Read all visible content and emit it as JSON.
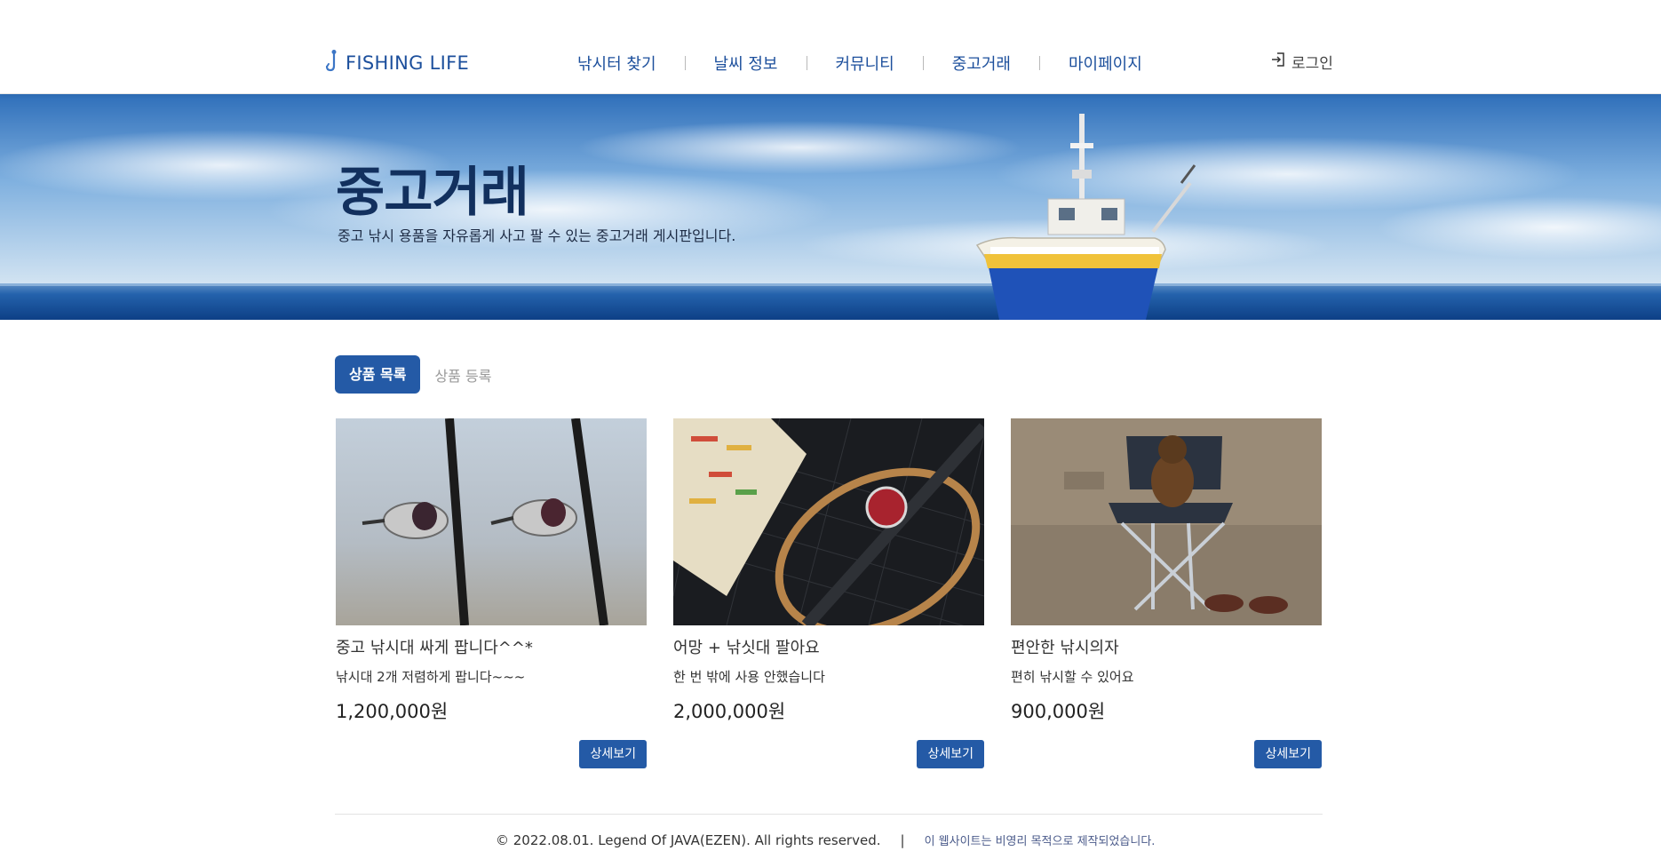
{
  "header": {
    "logo_text": "FISHING LIFE",
    "nav": [
      {
        "label": "낚시터 찾기"
      },
      {
        "label": "날씨 정보"
      },
      {
        "label": "커뮤니티"
      },
      {
        "label": "중고거래"
      },
      {
        "label": "마이페이지"
      }
    ],
    "login_label": "로그인"
  },
  "hero": {
    "title": "중고거래",
    "subtitle": "중고 낚시 용품을 자유롭게 사고 팔 수 있는 중고거래 게시판입니다."
  },
  "tabs": {
    "active": "상품 목록",
    "other": "상품 등록"
  },
  "products": [
    {
      "title": "중고 낚시대 싸게 팝니다^^*",
      "desc": "낚시대 2개 저렴하게 팝니다~~~",
      "price": "1,200,000원",
      "button": "상세보기",
      "image": "fishing-rods-photo"
    },
    {
      "title": "어망 + 낚싯대 팔아요",
      "desc": "한 번 밖에 사용 안했습니다",
      "price": "2,000,000원",
      "button": "상세보기",
      "image": "net-and-reel-photo"
    },
    {
      "title": "편안한 낚시의자",
      "desc": "편히 낚시할 수 있어요",
      "price": "900,000원",
      "button": "상세보기",
      "image": "fishing-chair-photo"
    }
  ],
  "footer": {
    "copyright": "© 2022.08.01.  Legend Of JAVA(EZEN).  All rights reserved.",
    "separator": "|",
    "note": "이 웹사이트는 비영리 목적으로 제작되었습니다."
  },
  "colors": {
    "brand": "#1c4f9c",
    "button": "#245aa6"
  }
}
